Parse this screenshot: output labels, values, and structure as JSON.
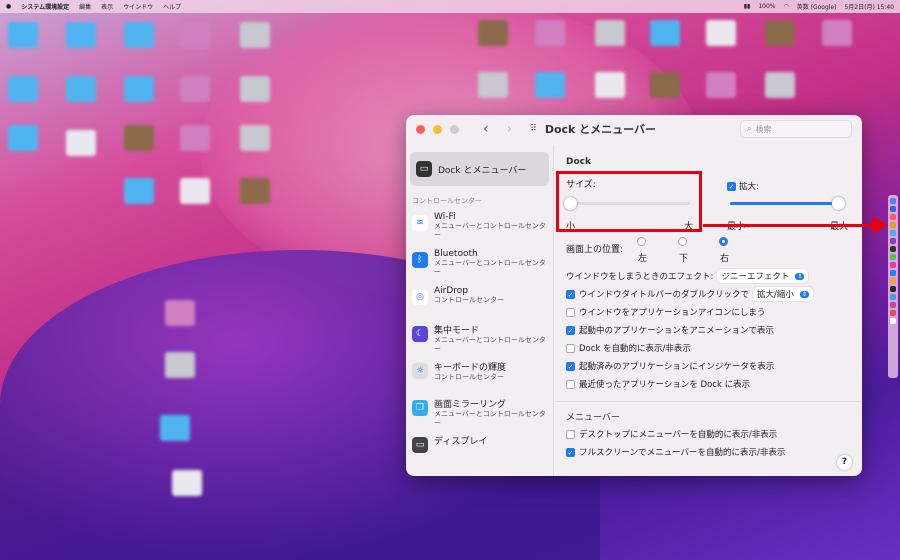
{
  "menubar": {
    "app": "システム環境設定",
    "items": [
      "編集",
      "表示",
      "ウインドウ",
      "ヘルプ"
    ],
    "battery": "100%",
    "input": "英数 (Google)",
    "clock": "5月2日(月) 15:40"
  },
  "window": {
    "title": "Dock とメニューバー",
    "search_placeholder": "検索"
  },
  "sidebar": {
    "selected": "Dock とメニューバー",
    "section": "コントロールセンター",
    "items": [
      {
        "name": "Wi-Fi",
        "sub": "メニューバーとコントロールセンター",
        "icon": "wifi-icon",
        "color": "#ffffff"
      },
      {
        "name": "Bluetooth",
        "sub": "メニューバーとコントロールセンター",
        "icon": "bluetooth-icon",
        "color": "#1f7aef"
      },
      {
        "name": "AirDrop",
        "sub": "コントロールセンター",
        "icon": "airdrop-icon",
        "color": "#ffffff"
      },
      {
        "name": "集中モード",
        "sub": "メニューバーとコントロールセンター",
        "icon": "moon-icon",
        "color": "#5b45d6"
      },
      {
        "name": "キーボードの輝度",
        "sub": "コントロールセンター",
        "icon": "keyboard-brightness-icon",
        "color": "#dddddd"
      },
      {
        "name": "画面ミラーリング",
        "sub": "メニューバーとコントロールセンター",
        "icon": "screen-mirroring-icon",
        "color": "#34aaf0"
      },
      {
        "name": "ディスプレイ",
        "sub": "",
        "icon": "display-icon",
        "color": "#444444"
      }
    ]
  },
  "dock": {
    "heading": "Dock",
    "size_label": "サイズ:",
    "size_min": "小",
    "size_max": "大",
    "size_value": 0,
    "magnify_label": "拡大:",
    "magnify_checked": true,
    "magnify_min": "最小",
    "magnify_max": "最大",
    "magnify_value": 1,
    "position_label": "画面上の位置:",
    "positions": [
      "左",
      "下",
      "右"
    ],
    "position_selected": "右",
    "effect_label": "ウインドウをしまうときのエフェクト:",
    "effect_value": "ジニーエフェクト",
    "dblclick_label": "ウインドウタイトルバーのダブルクリックで",
    "dblclick_checked": true,
    "dblclick_value": "拡大/縮小",
    "options": [
      {
        "label": "ウインドウをアプリケーションアイコンにしまう",
        "checked": false
      },
      {
        "label": "起動中のアプリケーションをアニメーションで表示",
        "checked": true
      },
      {
        "label": "Dock を自動的に表示/非表示",
        "checked": false
      },
      {
        "label": "起動済みのアプリケーションにインジケータを表示",
        "checked": true
      },
      {
        "label": "最近使ったアプリケーションを Dock に表示",
        "checked": false
      }
    ]
  },
  "menubar_section": {
    "heading": "メニューバー",
    "options": [
      {
        "label": "デスクトップにメニューバーを自動的に表示/非表示",
        "checked": false
      },
      {
        "label": "フルスクリーンでメニューバーを自動的に表示/非表示",
        "checked": true
      }
    ]
  },
  "help": "?",
  "colors": {
    "accent": "#1f7aef",
    "highlight": "#e60012"
  }
}
